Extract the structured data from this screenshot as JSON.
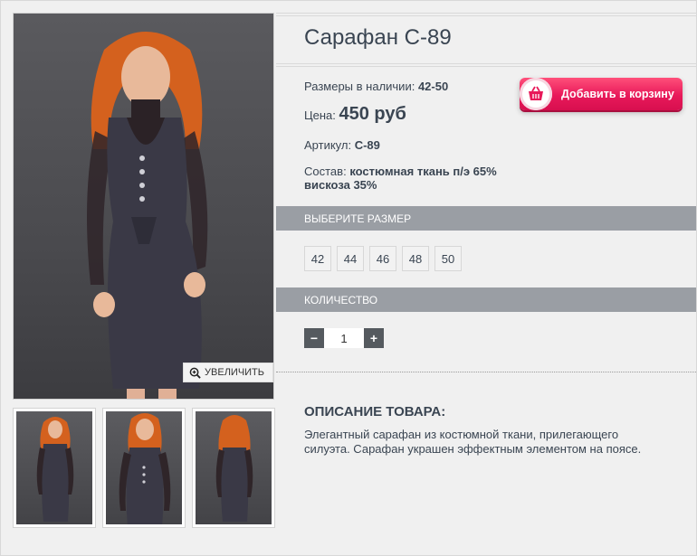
{
  "product": {
    "title": "Сарафан С-89",
    "sizes_label": "Размеры в наличии:",
    "sizes_value": "42-50",
    "price_label": "Цена:",
    "price_value": "450 руб",
    "sku_label": "Артикул:",
    "sku_value": "С-89",
    "composition_label": "Состав:",
    "composition_value": "костюмная ткань п/э 65% вискоза 35%"
  },
  "gallery": {
    "zoom_label": "УВЕЛИЧИТЬ",
    "thumbnail_count": 3
  },
  "cart": {
    "button_label": "Добавить в корзину",
    "icon": "basket-icon"
  },
  "size_picker": {
    "title": "ВЫБЕРИТЕ РАЗМЕР",
    "options": [
      "42",
      "44",
      "46",
      "48",
      "50"
    ]
  },
  "quantity": {
    "title": "КОЛИЧЕСТВО",
    "minus": "−",
    "plus": "+",
    "value": "1"
  },
  "description": {
    "title": "ОПИСАНИЕ ТОВАРА:",
    "text": "Элегантный сарафан из костюмной ткани, прилегающего силуэта. Сарафан украшен эффектным элементом на поясе."
  },
  "colors": {
    "accent": "#e8195a",
    "bar": "#9a9ea4",
    "text": "#3a4552"
  }
}
